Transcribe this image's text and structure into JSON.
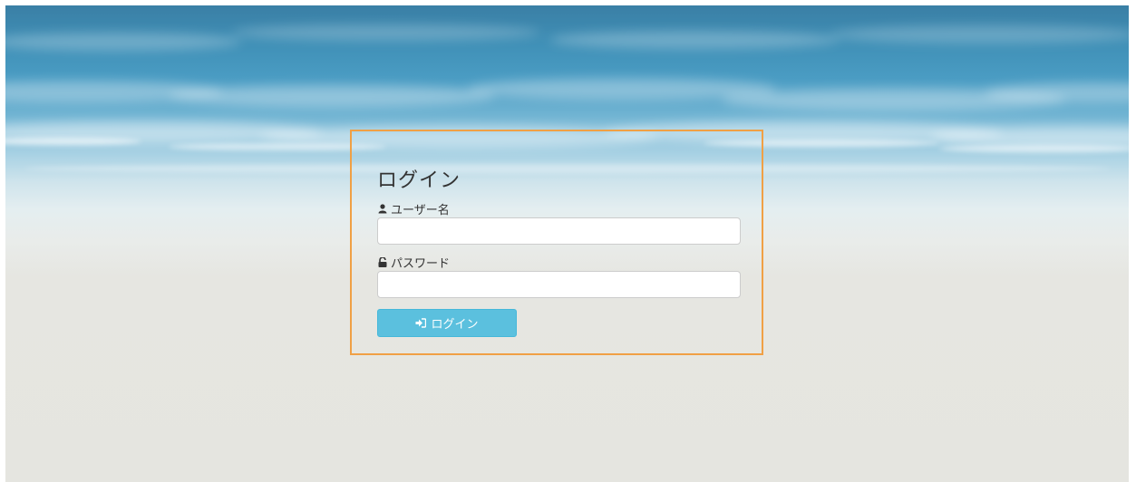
{
  "login": {
    "title": "ログイン",
    "username_label": "ユーザー名",
    "username_value": "",
    "username_placeholder": "",
    "password_label": "パスワード",
    "password_value": "",
    "password_placeholder": "",
    "submit_label": "ログイン"
  },
  "icons": {
    "username": "user-icon",
    "password": "unlock-icon",
    "submit": "sign-in-icon"
  },
  "colors": {
    "box_border": "#f0a045",
    "button_bg": "#5bc0de",
    "button_text": "#ffffff",
    "sky_top": "#3a7fa5",
    "ground": "#e5e5e0"
  }
}
